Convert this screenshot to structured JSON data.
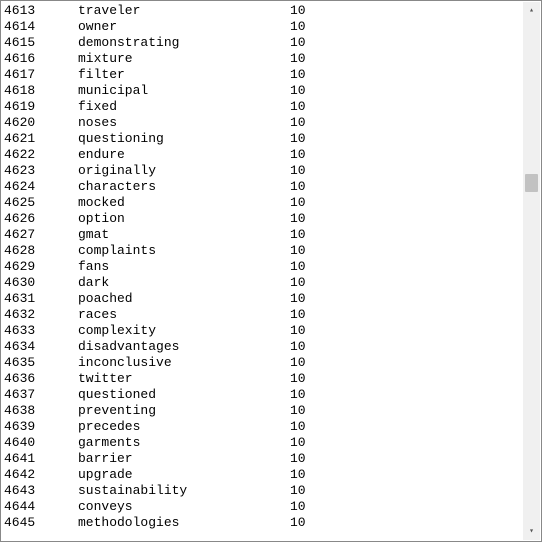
{
  "rows": [
    {
      "n": "4613",
      "w": "traveler",
      "c": "10"
    },
    {
      "n": "4614",
      "w": "owner",
      "c": "10"
    },
    {
      "n": "4615",
      "w": "demonstrating",
      "c": "10"
    },
    {
      "n": "4616",
      "w": "mixture",
      "c": "10"
    },
    {
      "n": "4617",
      "w": "filter",
      "c": "10"
    },
    {
      "n": "4618",
      "w": "municipal",
      "c": "10"
    },
    {
      "n": "4619",
      "w": "fixed",
      "c": "10"
    },
    {
      "n": "4620",
      "w": "noses",
      "c": "10"
    },
    {
      "n": "4621",
      "w": "questioning",
      "c": "10"
    },
    {
      "n": "4622",
      "w": "endure",
      "c": "10"
    },
    {
      "n": "4623",
      "w": "originally",
      "c": "10"
    },
    {
      "n": "4624",
      "w": "characters",
      "c": "10"
    },
    {
      "n": "4625",
      "w": "mocked",
      "c": "10"
    },
    {
      "n": "4626",
      "w": "option",
      "c": "10"
    },
    {
      "n": "4627",
      "w": "gmat",
      "c": "10"
    },
    {
      "n": "4628",
      "w": "complaints",
      "c": "10"
    },
    {
      "n": "4629",
      "w": "fans",
      "c": "10"
    },
    {
      "n": "4630",
      "w": "dark",
      "c": "10"
    },
    {
      "n": "4631",
      "w": "poached",
      "c": "10"
    },
    {
      "n": "4632",
      "w": "races",
      "c": "10"
    },
    {
      "n": "4633",
      "w": "complexity",
      "c": "10"
    },
    {
      "n": "4634",
      "w": "disadvantages",
      "c": "10"
    },
    {
      "n": "4635",
      "w": "inconclusive",
      "c": "10"
    },
    {
      "n": "4636",
      "w": "twitter",
      "c": "10"
    },
    {
      "n": "4637",
      "w": "questioned",
      "c": "10"
    },
    {
      "n": "4638",
      "w": "preventing",
      "c": "10"
    },
    {
      "n": "4639",
      "w": "precedes",
      "c": "10"
    },
    {
      "n": "4640",
      "w": "garments",
      "c": "10"
    },
    {
      "n": "4641",
      "w": "barrier",
      "c": "10"
    },
    {
      "n": "4642",
      "w": "upgrade",
      "c": "10"
    },
    {
      "n": "4643",
      "w": "sustainability",
      "c": "10"
    },
    {
      "n": "4644",
      "w": "conveys",
      "c": "10"
    },
    {
      "n": "4645",
      "w": "methodologies",
      "c": "10"
    }
  ]
}
